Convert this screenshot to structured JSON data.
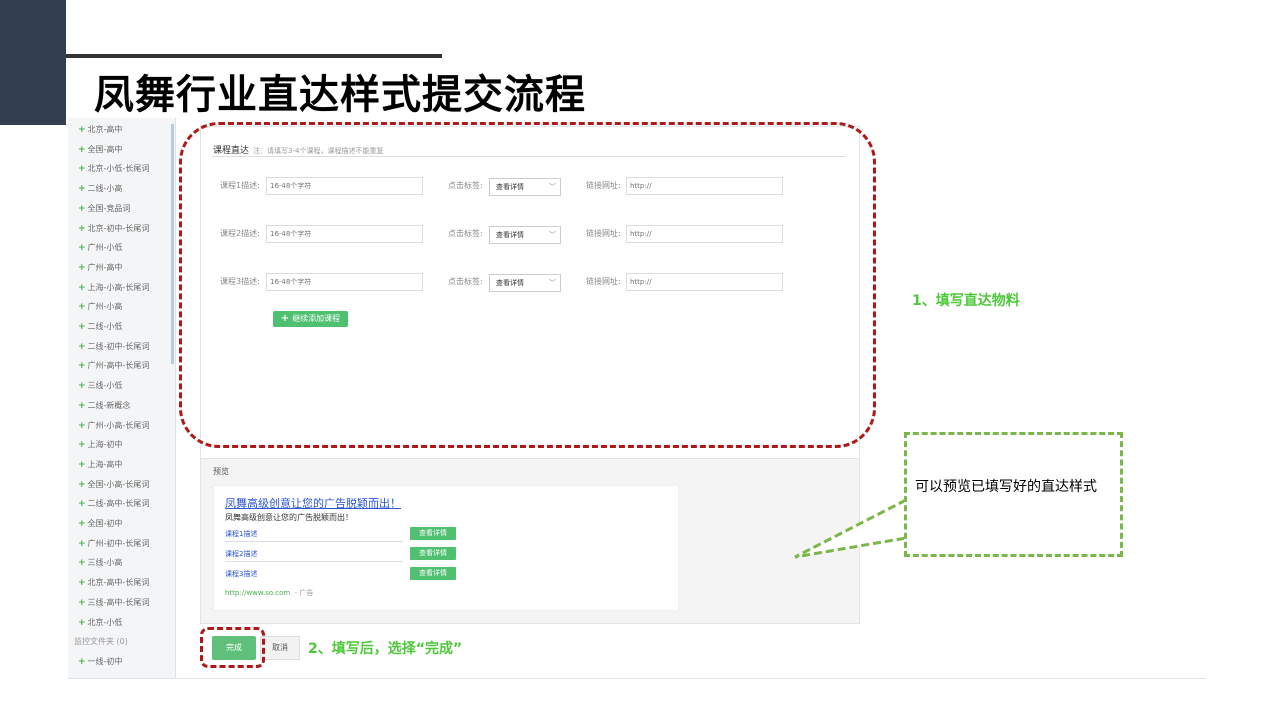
{
  "slide": {
    "title": "凤舞行业直达样式提交流程"
  },
  "sidebar": {
    "items": [
      "北京-高中",
      "全国-高中",
      "北京-小低-长尾词",
      "二线-小高",
      "全国-竞品词",
      "北京-初中-长尾词",
      "广州-小低",
      "广州-高中",
      "上海-小高-长尾词",
      "广州-小高",
      "二线-小低",
      "二线-初中-长尾词",
      "广州-高中-长尾词",
      "三线-小低",
      "二线-新概念",
      "广州-小高-长尾词",
      "上海-初中",
      "上海-高中",
      "全国-小高-长尾词",
      "二线-高中-长尾词",
      "全国-初中",
      "广州-初中-长尾词",
      "三线-小高",
      "北京-高中-长尾词",
      "三线-高中-长尾词",
      "北京-小低"
    ],
    "group_label": "监控文件夹 (0)",
    "last_item": "一线-初中"
  },
  "form": {
    "section_title": "课程直达",
    "section_note": "注：请填写3-4个课程，课程描述不能重复",
    "rows": [
      {
        "desc_label": "课程1描述:",
        "desc_placeholder": "16-48个字符",
        "tag_label": "点击标签:",
        "tag_value": "查看详情",
        "url_label": "链接网址:",
        "url_placeholder": "http://"
      },
      {
        "desc_label": "课程2描述:",
        "desc_placeholder": "16-48个字符",
        "tag_label": "点击标签:",
        "tag_value": "查看详情",
        "url_label": "链接网址:",
        "url_placeholder": "http://"
      },
      {
        "desc_label": "课程3描述:",
        "desc_placeholder": "16-48个字符",
        "tag_label": "点击标签:",
        "tag_value": "查看详情",
        "url_label": "链接网址:",
        "url_placeholder": "http://"
      }
    ],
    "add_button": "继续添加课程"
  },
  "preview": {
    "label": "预览",
    "ad_title": "凤舞高级创意让您的广告脱颖而出！",
    "ad_desc": "凤舞高级创意让您的广告脱颖而出！",
    "courses": [
      {
        "name": "课程1描述",
        "button": "查看详情"
      },
      {
        "name": "课程2描述",
        "button": "查看详情"
      },
      {
        "name": "课程3描述",
        "button": "查看详情"
      }
    ],
    "url": "http://www.so.com",
    "ad_tag": "- 广告"
  },
  "actions": {
    "done": "完成",
    "cancel": "取消"
  },
  "annotations": {
    "step1": "1、填写直达物料",
    "step2": "2、填写后，选择“完成”",
    "callout": "可以预览已填写好的直达样式"
  },
  "colors": {
    "accent_green": "#4ec83a",
    "dash_red": "#b01818",
    "dash_green": "#7ab648",
    "corner": "#333f50"
  }
}
